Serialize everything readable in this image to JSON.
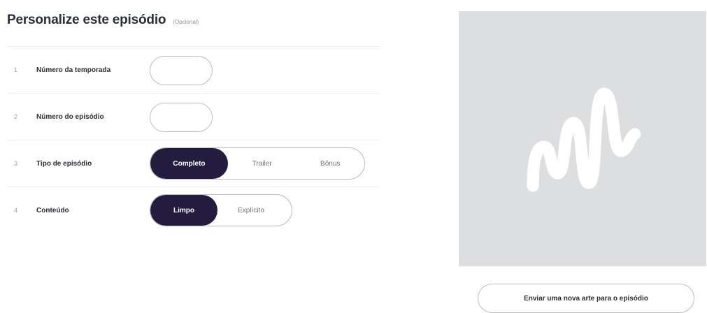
{
  "header": {
    "title": "Personalize este episódio",
    "optional": "(Opcional)"
  },
  "rows": [
    {
      "number": "1",
      "label": "Número da temporada",
      "value": ""
    },
    {
      "number": "2",
      "label": "Número do episódio",
      "value": ""
    },
    {
      "number": "3",
      "label": "Tipo de episódio",
      "options": [
        "Completo",
        "Trailer",
        "Bônus"
      ],
      "selected": "Completo"
    },
    {
      "number": "4",
      "label": "Conteúdo",
      "options": [
        "Limpo",
        "Explícito"
      ],
      "selected": "Limpo"
    }
  ],
  "artwork": {
    "icon": "anchor-logo-icon",
    "upload_label": "Enviar uma nova arte para o episódio"
  },
  "colors": {
    "selected_bg": "#231c3f",
    "art_bg": "#dcdee0"
  }
}
